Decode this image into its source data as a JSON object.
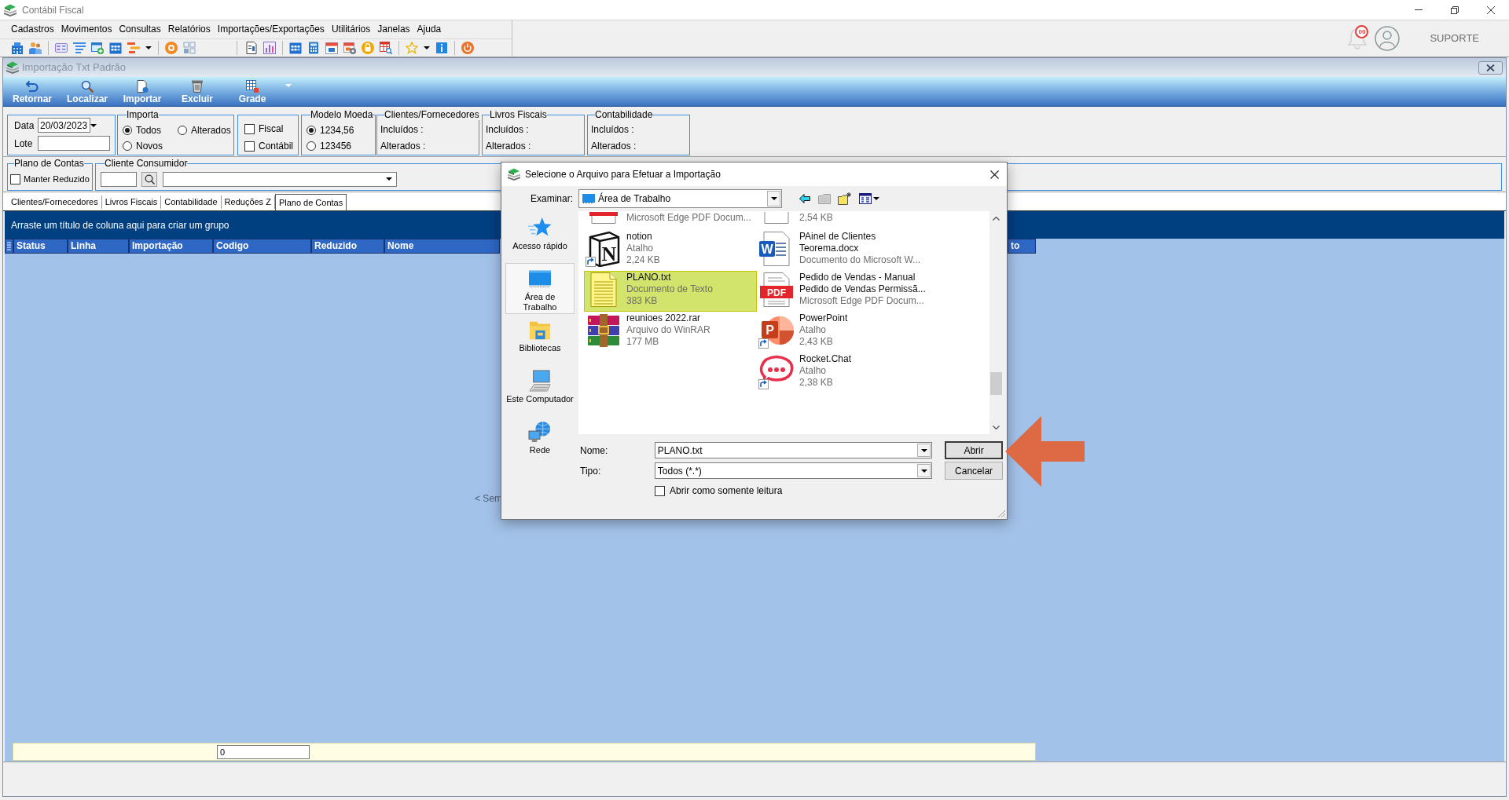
{
  "window": {
    "title": "Contábil Fiscal"
  },
  "menu": [
    "Cadastros",
    "Movimentos",
    "Consultas",
    "Relatórios",
    "Importações/Exportações",
    "Utilitários",
    "Janelas",
    "Ajuda"
  ],
  "account": {
    "notifications": "00",
    "user": "SUPORTE"
  },
  "child_window": {
    "title": "Importação Txt Padrão",
    "actions": [
      {
        "label": "Retornar",
        "kind": "back"
      },
      {
        "label": "Localizar",
        "kind": "search"
      },
      {
        "label": "Importar",
        "kind": "import"
      },
      {
        "label": "Excluir",
        "kind": "delete"
      },
      {
        "label": "Grade",
        "kind": "grid"
      }
    ]
  },
  "filters": {
    "date": {
      "label": "Data",
      "value": "20/03/2023"
    },
    "batch": {
      "label": "Lote"
    },
    "importa": {
      "title": "Importa",
      "options": [
        {
          "label": "Todos",
          "selected": true
        },
        {
          "label": "Alterados",
          "selected": false
        },
        {
          "label": "Novos",
          "selected": false
        }
      ]
    },
    "document_types": [
      {
        "label": "Fiscal",
        "checked": false
      },
      {
        "label": "Contábil",
        "checked": false
      }
    ],
    "modelo_moeda": {
      "title": "Modelo Moeda",
      "options": [
        {
          "label": "1234,56",
          "selected": true
        },
        {
          "label": "123456",
          "selected": false
        }
      ]
    },
    "summaries": [
      {
        "title": "Clientes/Fornecedores",
        "rows": [
          "Incluídos :",
          "Alterados :"
        ]
      },
      {
        "title": "Livros Fiscais",
        "rows": [
          "Incluídos :",
          "Alterados :"
        ]
      },
      {
        "title": "Contabilidade",
        "rows": [
          "Incluídos :",
          "Alterados :"
        ]
      }
    ]
  },
  "plano_de_contas": {
    "title": "Plano de Contas",
    "option": {
      "label": "Manter Reduzido",
      "checked": false
    }
  },
  "cliente_consumidor": {
    "title": "Cliente Consumidor"
  },
  "tabs": [
    {
      "label": "Clientes/Fornecedores",
      "selected": false
    },
    {
      "label": "Livros Fiscais",
      "selected": false
    },
    {
      "label": "Contabilidade",
      "selected": false
    },
    {
      "label": "Reduções Z",
      "selected": false
    },
    {
      "label": "Plano de Contas",
      "selected": true
    }
  ],
  "grid": {
    "group_hint": "Arraste um título de coluna aqui para criar um grupo",
    "columns": [
      "Status",
      "Linha",
      "Importação",
      "Codigo",
      "Reduzido",
      "Nome",
      "to"
    ],
    "empty_text": "< Sem",
    "footer_value": "0"
  },
  "dialog": {
    "title": "Selecione o Arquivo para Efetuar a Importação",
    "look_in": {
      "label": "Examinar:",
      "value": "Área de Trabalho"
    },
    "places": [
      {
        "lines": [
          "Acesso rápido"
        ],
        "kind": "quick",
        "selected": false
      },
      {
        "lines": [
          "Área de",
          "Trabalho"
        ],
        "kind": "desktop",
        "selected": true
      },
      {
        "lines": [
          "Bibliotecas"
        ],
        "kind": "libraries",
        "selected": false
      },
      {
        "lines": [
          "Este Computador"
        ],
        "kind": "computer",
        "selected": false
      },
      {
        "lines": [
          "Rede"
        ],
        "kind": "network",
        "selected": false
      }
    ],
    "file_columns": [
      [
        {
          "kind": "pdf",
          "partial": true,
          "details": [
            "Microsoft Edge PDF Docum..."
          ],
          "selected": false,
          "shortcut": false
        },
        {
          "kind": "cube",
          "icon_text": "N",
          "partial": false,
          "name_lines": [
            "notion"
          ],
          "details": [
            "Atalho",
            "2,24 KB"
          ],
          "selected": false,
          "shortcut": true
        },
        {
          "kind": "text",
          "partial": false,
          "name_lines": [
            "PLANO.txt"
          ],
          "details": [
            "Documento de Texto",
            "383 KB"
          ],
          "selected": true,
          "shortcut": false
        },
        {
          "kind": "archive",
          "partial": false,
          "name_lines": [
            "reunioes 2022.rar"
          ],
          "details": [
            "Arquivo do WinRAR",
            "177 MB"
          ],
          "selected": false,
          "shortcut": false
        }
      ],
      [
        {
          "kind": "document",
          "partial": true,
          "details": [
            "2,54 KB"
          ],
          "selected": false,
          "shortcut": false
        },
        {
          "kind": "word",
          "icon_text": "W",
          "partial": false,
          "name_lines": [
            "PAinel de Clientes",
            "Teorema.docx"
          ],
          "details": [
            "Documento do Microsoft W..."
          ],
          "selected": false,
          "shortcut": false
        },
        {
          "kind": "pdf",
          "icon_text": "PDF",
          "partial": false,
          "name_lines": [
            "Pedido de Vendas - Manual",
            "Pedido de Vendas Permissã..."
          ],
          "details": [
            "Microsoft Edge PDF Docum..."
          ],
          "selected": false,
          "shortcut": false
        },
        {
          "kind": "presentation",
          "icon_text": "P",
          "partial": false,
          "name_lines": [
            "PowerPoint"
          ],
          "details": [
            "Atalho",
            "2,43 KB"
          ],
          "selected": false,
          "shortcut": true
        },
        {
          "kind": "chat",
          "partial": false,
          "name_lines": [
            "Rocket.Chat"
          ],
          "details": [
            "Atalho",
            "2,38 KB"
          ],
          "selected": false,
          "shortcut": true
        }
      ]
    ],
    "name_field": {
      "label": "Nome:",
      "value": "PLANO.txt"
    },
    "type_field": {
      "label": "Tipo:",
      "value": "Todos (*.*)"
    },
    "read_only": {
      "label": "Abrir como somente leitura",
      "checked": false
    },
    "buttons": [
      {
        "label": "Abrir",
        "default": true
      },
      {
        "label": "Cancelar",
        "default": false
      }
    ]
  }
}
